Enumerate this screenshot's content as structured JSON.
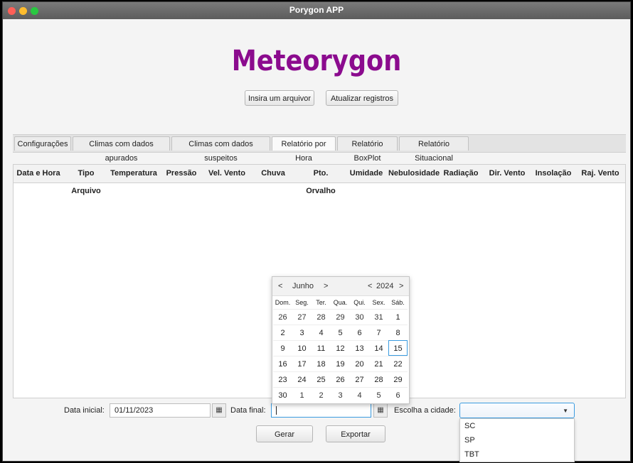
{
  "window": {
    "title": "Porygon APP"
  },
  "app": {
    "title": "Meteorygon"
  },
  "buttons": {
    "insert_file": "Insira um arquivor",
    "update_records": "Atualizar registros",
    "generate": "Gerar",
    "export": "Exportar"
  },
  "tabs": [
    {
      "label": "Configurações"
    },
    {
      "label": "Climas com dados apurados"
    },
    {
      "label": "Climas com dados suspeitos"
    },
    {
      "label": "Relatório por Hora",
      "active": true
    },
    {
      "label": "Relatório BoxPlot"
    },
    {
      "label": "Relatório Situacional"
    }
  ],
  "table": {
    "columns": [
      "Data e Hora",
      "Tipo Arquivo",
      "Temperatura",
      "Pressão",
      "Vel. Vento",
      "Chuva",
      "Pto. Orvalho",
      "Umidade",
      "Nebulosidade",
      "Radiação",
      "Dir. Vento",
      "Insolação",
      "Raj. Vento"
    ]
  },
  "form": {
    "start_label": "Data inicial:",
    "start_value": "01/11/2023",
    "end_label": "Data final:",
    "end_value": "",
    "city_label": "Escolha a cidade:",
    "city_value": "",
    "city_options": [
      "SC",
      "SP",
      "TBT"
    ]
  },
  "calendar": {
    "month": "Junho",
    "year": "2024",
    "prev": "<",
    "next": ">",
    "weekdays": [
      "Dom.",
      "Seg.",
      "Ter.",
      "Qua.",
      "Qui.",
      "Sex.",
      "Sáb."
    ],
    "weeks": [
      [
        "26",
        "27",
        "28",
        "29",
        "30",
        "31",
        "1"
      ],
      [
        "2",
        "3",
        "4",
        "5",
        "6",
        "7",
        "8"
      ],
      [
        "9",
        "10",
        "11",
        "12",
        "13",
        "14",
        "15"
      ],
      [
        "16",
        "17",
        "18",
        "19",
        "20",
        "21",
        "22"
      ],
      [
        "23",
        "24",
        "25",
        "26",
        "27",
        "28",
        "29"
      ],
      [
        "30",
        "1",
        "2",
        "3",
        "4",
        "5",
        "6"
      ]
    ],
    "selected": "15"
  },
  "icons": {
    "calendar": "calendar-icon",
    "chevron": "chevron-down-icon"
  },
  "colors": {
    "title": "#8b0b8e",
    "focus": "#3a9be0"
  }
}
